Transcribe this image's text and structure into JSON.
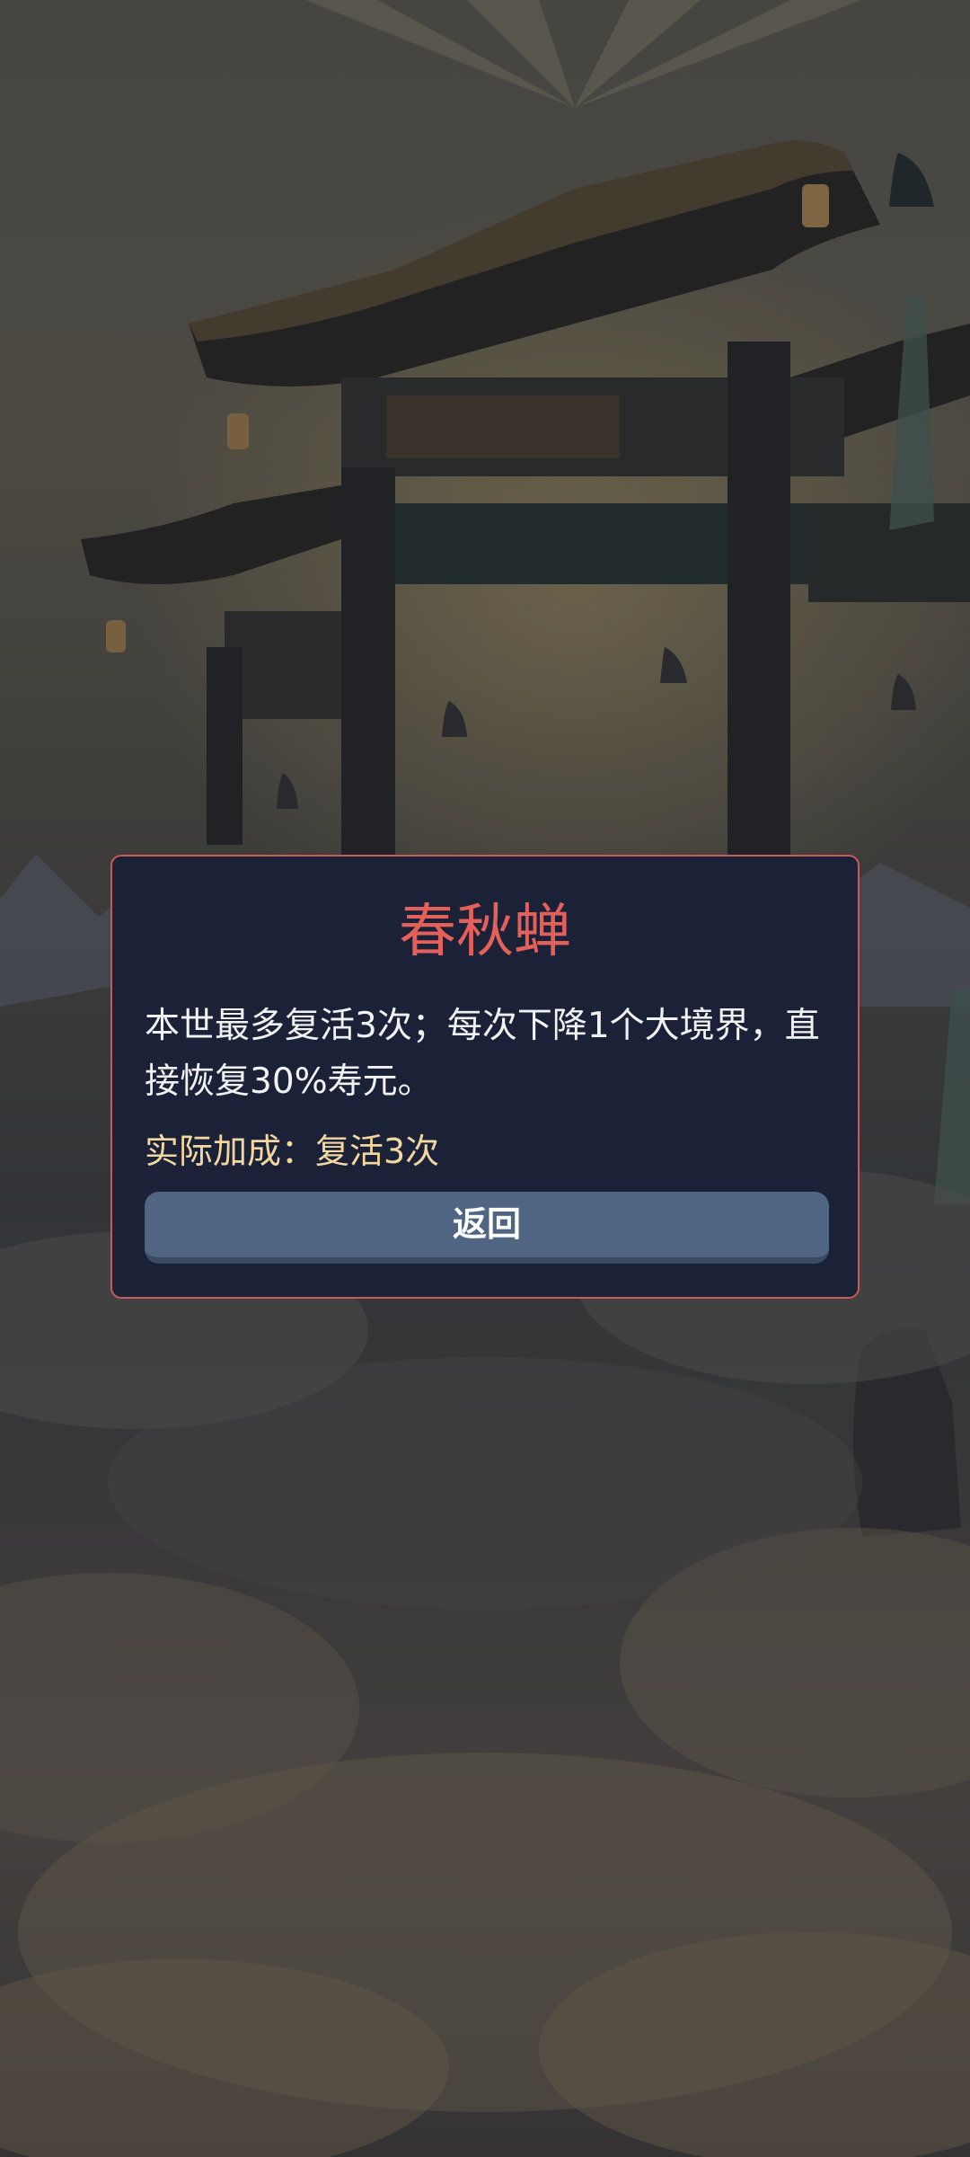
{
  "dialog": {
    "title": "春秋蝉",
    "description": "本世最多复活3次；每次下降1个大境界，直接恢复30%寿元。",
    "bonus": "实际加成：复活3次",
    "back_button_label": "返回"
  },
  "colors": {
    "dialog_background": "#1b2237",
    "dialog_border": "#c85a58",
    "title": "#e4605a",
    "bonus_text": "#f3d7a0",
    "button": "#506581"
  },
  "background_icon": "temple-gate-illustration"
}
